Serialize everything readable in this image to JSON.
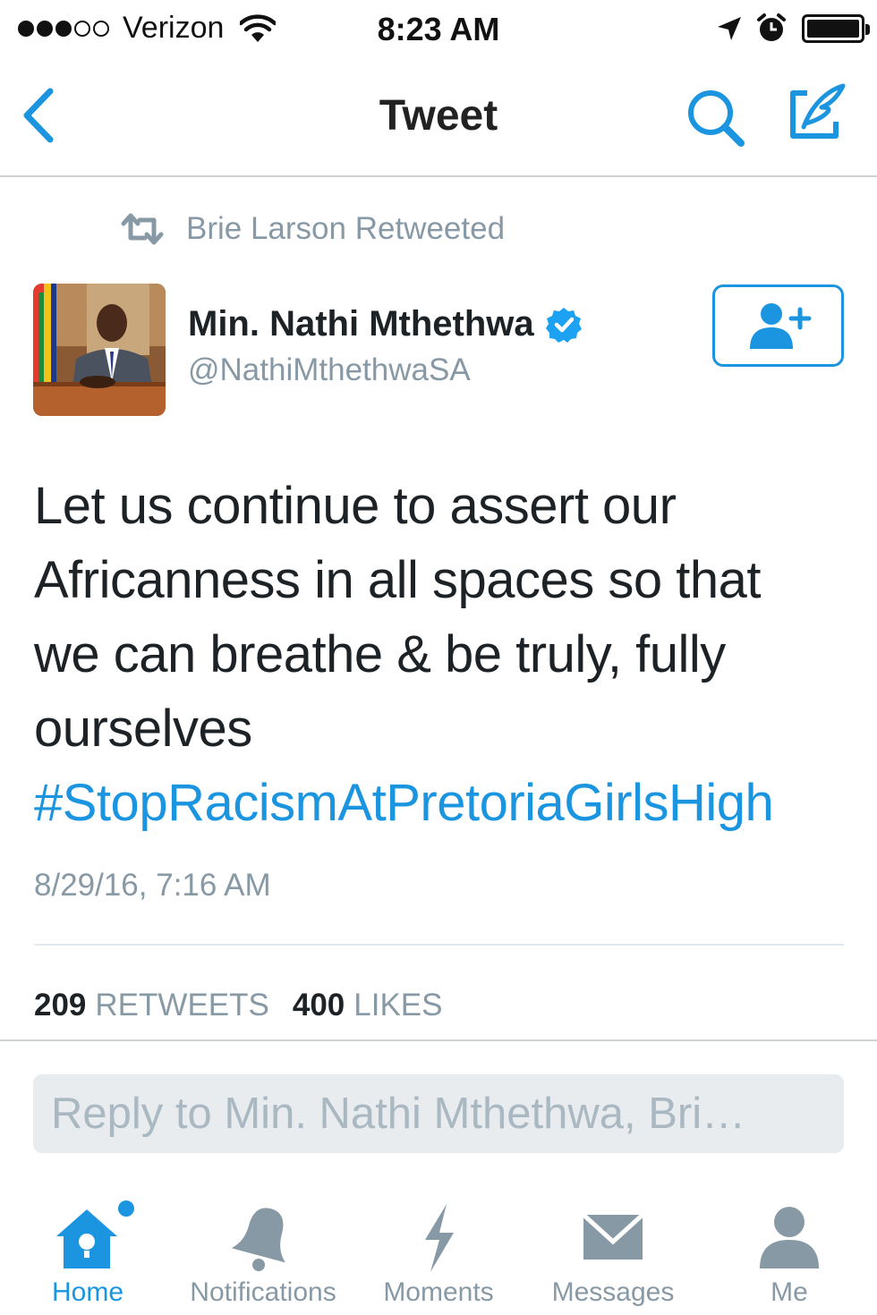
{
  "status_bar": {
    "carrier": "Verizon",
    "time": "8:23 AM",
    "signal_strength": 3,
    "signal_max": 5
  },
  "nav": {
    "title": "Tweet",
    "back_icon": "chevron-left-icon",
    "search_icon": "search-icon",
    "compose_icon": "compose-icon"
  },
  "retweet_context": {
    "text": "Brie Larson Retweeted",
    "icon": "retweet-icon"
  },
  "tweet": {
    "author_name": "Min. Nathi Mthethwa",
    "author_handle": "@NathiMthethwaSA",
    "verified": true,
    "text_lines": [
      "Let us continue to assert our",
      "Africanness in all spaces so that",
      "we can breathe & be truly, fully",
      "ourselves"
    ],
    "hashtag": "#StopRacismAtPretoriaGirlsHigh",
    "timestamp": "8/29/16, 7:16 AM",
    "retweets_count": "209",
    "retweets_label": "RETWEETS",
    "likes_count": "400",
    "likes_label": "LIKES"
  },
  "reply": {
    "placeholder": "Reply to Min. Nathi Mthethwa, Bri…"
  },
  "tabs": [
    {
      "label": "Home",
      "icon": "home-icon",
      "active": true
    },
    {
      "label": "Notifications",
      "icon": "bell-icon",
      "active": false
    },
    {
      "label": "Moments",
      "icon": "lightning-icon",
      "active": false
    },
    {
      "label": "Messages",
      "icon": "envelope-icon",
      "active": false
    },
    {
      "label": "Me",
      "icon": "person-icon",
      "active": false
    }
  ],
  "colors": {
    "accent": "#1b95e0",
    "secondary_text": "#8899a6",
    "primary_text": "#1c2226",
    "verified": "#1da1f2"
  }
}
